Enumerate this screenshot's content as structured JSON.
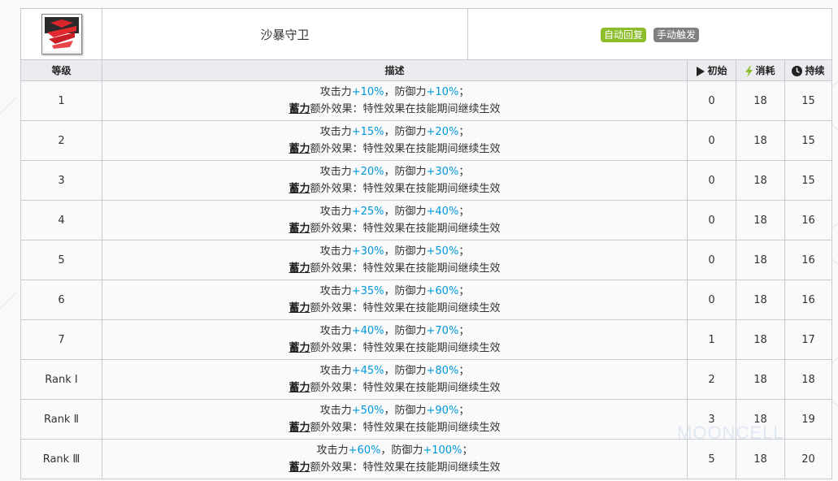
{
  "skill": {
    "name": "沙暴守卫",
    "recovery_tag": "自动回复",
    "trigger_tag": "手动触发",
    "recovery_color": "#8cbd2b",
    "trigger_color": "#808080"
  },
  "columns": {
    "level": "等级",
    "description": "描述",
    "initial": "初始",
    "cost": "消耗",
    "duration": "持续"
  },
  "icons": {
    "initial": "play-icon",
    "cost": "lightning-icon",
    "duration": "clock-icon"
  },
  "accent_color": "#0098dc",
  "rows": [
    {
      "level": "1",
      "atk_label": "攻击力",
      "atk": "+10%",
      "sep": "，",
      "def_label": "防御力",
      "def": "+10%",
      "end": "；",
      "keyword": "蓄力",
      "effect": "额外效果：特性效果在技能期间继续生效",
      "initial": "0",
      "cost": "18",
      "duration": "15"
    },
    {
      "level": "2",
      "atk_label": "攻击力",
      "atk": "+15%",
      "sep": "，",
      "def_label": "防御力",
      "def": "+20%",
      "end": "；",
      "keyword": "蓄力",
      "effect": "额外效果：特性效果在技能期间继续生效",
      "initial": "0",
      "cost": "18",
      "duration": "15"
    },
    {
      "level": "3",
      "atk_label": "攻击力",
      "atk": "+20%",
      "sep": "，",
      "def_label": "防御力",
      "def": "+30%",
      "end": "；",
      "keyword": "蓄力",
      "effect": "额外效果：特性效果在技能期间继续生效",
      "initial": "0",
      "cost": "18",
      "duration": "15"
    },
    {
      "level": "4",
      "atk_label": "攻击力",
      "atk": "+25%",
      "sep": "，",
      "def_label": "防御力",
      "def": "+40%",
      "end": "；",
      "keyword": "蓄力",
      "effect": "额外效果：特性效果在技能期间继续生效",
      "initial": "0",
      "cost": "18",
      "duration": "16"
    },
    {
      "level": "5",
      "atk_label": "攻击力",
      "atk": "+30%",
      "sep": "，",
      "def_label": "防御力",
      "def": "+50%",
      "end": "；",
      "keyword": "蓄力",
      "effect": "额外效果：特性效果在技能期间继续生效",
      "initial": "0",
      "cost": "18",
      "duration": "16"
    },
    {
      "level": "6",
      "atk_label": "攻击力",
      "atk": "+35%",
      "sep": "，",
      "def_label": "防御力",
      "def": "+60%",
      "end": "；",
      "keyword": "蓄力",
      "effect": "额外效果：特性效果在技能期间继续生效",
      "initial": "0",
      "cost": "18",
      "duration": "16"
    },
    {
      "level": "7",
      "atk_label": "攻击力",
      "atk": "+40%",
      "sep": "，",
      "def_label": "防御力",
      "def": "+70%",
      "end": "；",
      "keyword": "蓄力",
      "effect": "额外效果：特性效果在技能期间继续生效",
      "initial": "1",
      "cost": "18",
      "duration": "17"
    },
    {
      "level": "Rank Ⅰ",
      "atk_label": "攻击力",
      "atk": "+45%",
      "sep": "，",
      "def_label": "防御力",
      "def": "+80%",
      "end": "；",
      "keyword": "蓄力",
      "effect": "额外效果：特性效果在技能期间继续生效",
      "initial": "2",
      "cost": "18",
      "duration": "18"
    },
    {
      "level": "Rank Ⅱ",
      "atk_label": "攻击力",
      "atk": "+50%",
      "sep": "，",
      "def_label": "防御力",
      "def": "+90%",
      "end": "；",
      "keyword": "蓄力",
      "effect": "额外效果：特性效果在技能期间继续生效",
      "initial": "3",
      "cost": "18",
      "duration": "19"
    },
    {
      "level": "Rank Ⅲ",
      "atk_label": "攻击力",
      "atk": "+60%",
      "sep": "，",
      "def_label": "防御力",
      "def": "+100%",
      "end": "；",
      "keyword": "蓄力",
      "effect": "额外效果：特性效果在技能期间继续生效",
      "initial": "5",
      "cost": "18",
      "duration": "20"
    }
  ],
  "watermark": "MOONCELL"
}
